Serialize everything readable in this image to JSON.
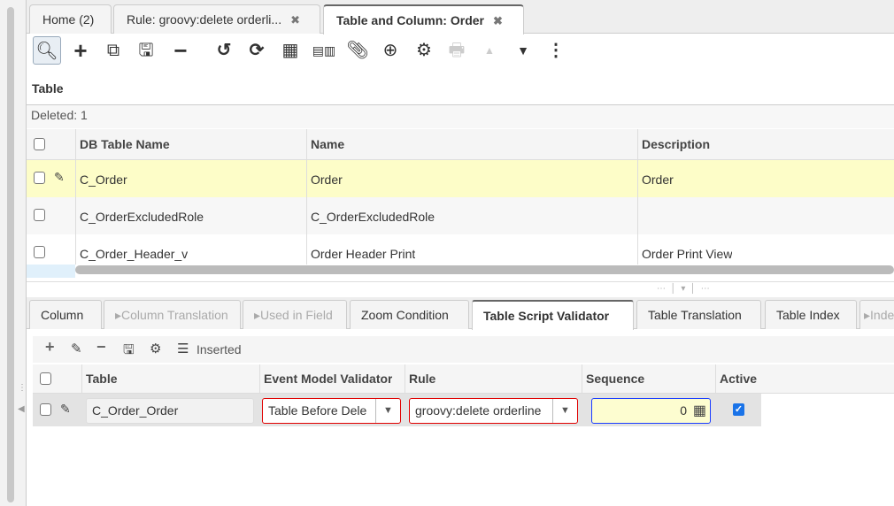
{
  "tabs": [
    {
      "label": "Home (2)"
    },
    {
      "label": "Rule: groovy:delete orderli...",
      "close": "✖"
    },
    {
      "label": "Table and Column: Order",
      "close": "✖",
      "active": true
    }
  ],
  "toolbar": {
    "icons": [
      "search-icon",
      "new-icon",
      "copy-icon",
      "save-icon",
      "delete-icon",
      "undo-icon",
      "refresh-icon",
      "grid-toggle-icon",
      "detail-icon",
      "attachment-icon",
      "zoom-across-icon",
      "settings-icon",
      "print-icon",
      "previous-icon",
      "next-icon",
      "more-icon"
    ]
  },
  "section_title": "Table",
  "status": "Deleted: 1",
  "main_grid": {
    "columns": [
      "DB Table Name",
      "Name",
      "Description"
    ],
    "rows": [
      {
        "db_name": "C_Order",
        "name": "Order",
        "description": "Order",
        "selected": true
      },
      {
        "db_name": "C_OrderExcludedRole",
        "name": "C_OrderExcludedRole",
        "description": ""
      },
      {
        "db_name": "C_Order_Header_v",
        "name": "Order Header Print",
        "description": "Order Print View"
      }
    ]
  },
  "subtabs": [
    {
      "label": "Column"
    },
    {
      "label": "Column Translation",
      "disabled": true
    },
    {
      "label": "Used in Field",
      "disabled": true
    },
    {
      "label": "Zoom Condition"
    },
    {
      "label": "Table Script Validator",
      "active": true
    },
    {
      "label": "Table Translation"
    },
    {
      "label": "Table Index"
    },
    {
      "label": "Inde",
      "disabled": true
    }
  ],
  "subtoolbar": {
    "status": "Inserted"
  },
  "detail_grid": {
    "columns": [
      "Table",
      "Event Model Validator",
      "Rule",
      "Sequence",
      "Active"
    ],
    "row": {
      "table": "C_Order_Order",
      "event_model_validator": "Table Before Dele",
      "rule": "groovy:delete orderline",
      "sequence": "0",
      "active": true
    }
  },
  "colors": {
    "selected_row": "#fdfdc8",
    "required_border": "#e00000",
    "focus_border": "#1a3cff",
    "focus_bg": "#fdfdd0",
    "checkbox_accent": "#1a73e8"
  }
}
